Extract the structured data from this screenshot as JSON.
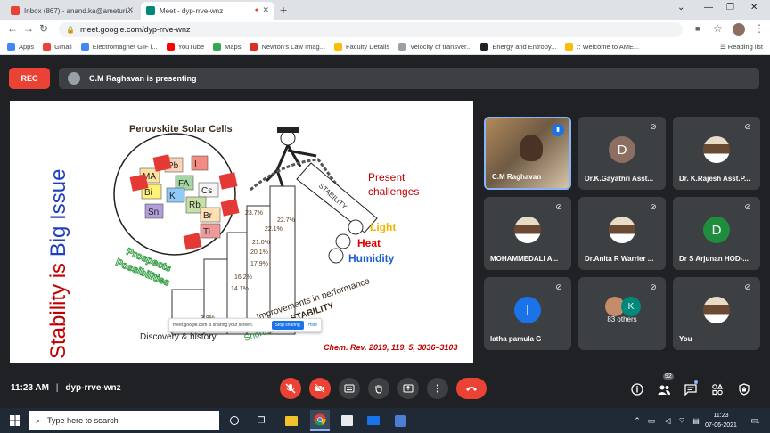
{
  "browser": {
    "tabs": [
      {
        "title": "Inbox (867) - anand.ka@ameturi...",
        "favicon_color": "#ea4335"
      },
      {
        "title": "Meet - dyp-rrve-wnz",
        "favicon_color": "#00897b"
      }
    ],
    "url": "meet.google.com/dyp-rrve-wnz",
    "bookmarks": [
      {
        "label": "Apps",
        "icon": "apps-grid-icon",
        "color": "#4285f4"
      },
      {
        "label": "Gmail",
        "icon": "gmail-icon",
        "color": "#ea4335"
      },
      {
        "label": "Electromagnet GIF i...",
        "icon": "google-icon",
        "color": "#4285f4"
      },
      {
        "label": "YouTube",
        "icon": "youtube-icon",
        "color": "#ff0000"
      },
      {
        "label": "Maps",
        "icon": "maps-icon",
        "color": "#34a853"
      },
      {
        "label": "Newton's Law Imag...",
        "icon": "site-icon",
        "color": "#d93025"
      },
      {
        "label": "Faculty Details",
        "icon": "site-icon",
        "color": "#fbbc04"
      },
      {
        "label": "Velocity of transver...",
        "icon": "site-icon",
        "color": "#9aa0a6"
      },
      {
        "label": "Energy and Entropy...",
        "icon": "site-icon",
        "color": "#202124"
      },
      {
        "label": ":: Welcome to AME...",
        "icon": "site-icon",
        "color": "#fbbc04"
      }
    ],
    "reading_list": "Reading list"
  },
  "meet": {
    "rec": "REC",
    "presenting": "C.M Raghavan is presenting",
    "time": "11:23 AM",
    "meeting_code": "dyp-rrve-wnz",
    "participant_count": "92",
    "tiles": [
      {
        "name": "C.M Raghavan",
        "type": "video"
      },
      {
        "name": "Dr.K.Gayathri Asst...",
        "type": "letter",
        "letter": "D",
        "color": "#8d6e63"
      },
      {
        "name": "Dr. K.Rajesh Asst.P...",
        "type": "photo"
      },
      {
        "name": "MOHAMMEDALI A...",
        "type": "photo"
      },
      {
        "name": "Dr.Anita R Warrier ...",
        "type": "photo"
      },
      {
        "name": "Dr S Arjunan HOD-...",
        "type": "letter",
        "letter": "D",
        "color": "#1e8e3e"
      },
      {
        "name": "latha pamula G",
        "type": "letter",
        "letter": "l",
        "color": "#1a73e8"
      },
      {
        "name": "83 others",
        "type": "others",
        "letter": "K",
        "color": "#00897b"
      },
      {
        "name": "You",
        "type": "photo"
      }
    ]
  },
  "slide": {
    "vertical_title_1": "Stability is ",
    "vertical_title_2": "Big Issue",
    "circle_title": "Perovskite Solar Cells",
    "present": "Present",
    "challenges": "challenges",
    "light": "Light",
    "heat": "Heat",
    "humidity": "Humidity",
    "prospects": "Prospects",
    "possibilities": "Possibilities",
    "discovery": "Discovery & history",
    "improvements": "Improvements in performance",
    "stability": "STABILITY",
    "shortcomings": "Shortcomings",
    "citation": "Chem. Rev. 2019, 119, 5, 3036–3103",
    "rope_label": "STABILITY",
    "elements": [
      "Pb",
      "MA",
      "FA",
      "I",
      "Bi",
      "K",
      "Cs",
      "Rb",
      "Sn",
      "Br",
      "Ti"
    ],
    "percentages": [
      "23.7%",
      "22.7%",
      "22.1%",
      "21.0%",
      "20.1%",
      "17.9%",
      "16.2%",
      "14.1%",
      "3.8%"
    ],
    "share_notice": "meet.google.com is sharing your screen.",
    "stop_sharing": "Stop sharing",
    "hide": "Hide"
  },
  "taskbar": {
    "search_placeholder": "Type here to search",
    "clock_time": "11:23",
    "clock_date": "07-06-2021",
    "notification_count": "1"
  }
}
